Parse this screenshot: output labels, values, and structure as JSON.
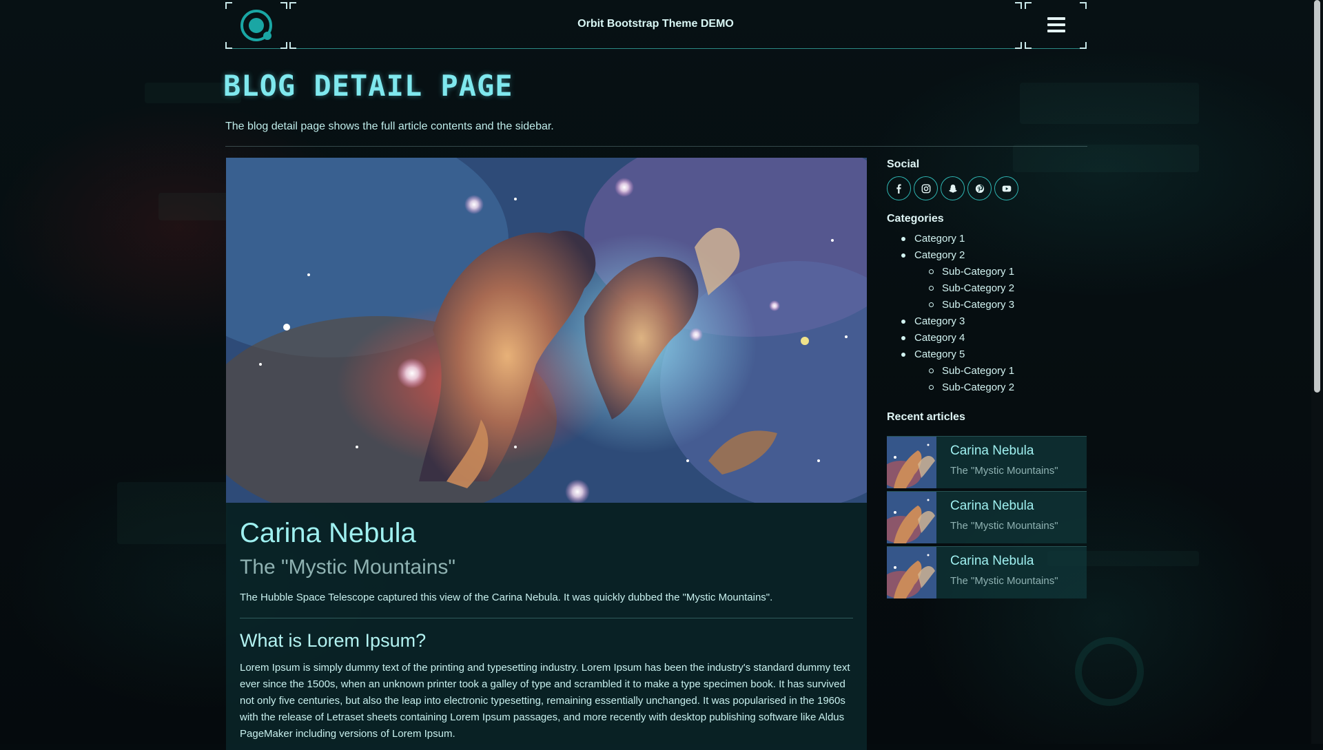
{
  "header": {
    "site_title": "Orbit Bootstrap Theme DEMO",
    "logo_icon": "orbit-logo",
    "menu_icon": "hamburger-icon"
  },
  "page": {
    "heading": "BLOG DETAIL PAGE",
    "lead": "The blog detail page shows the full article contents and the sidebar."
  },
  "article": {
    "image": "carina-nebula-image",
    "title": "Carina Nebula",
    "subtitle": "The \"Mystic Mountains\"",
    "intro": "The Hubble Space Telescope captured this view of the Carina Nebula. It was quickly dubbed the \"Mystic Mountains\".",
    "section_heading": "What is Lorem Ipsum?",
    "section_text": "Lorem Ipsum is simply dummy text of the printing and typesetting industry. Lorem Ipsum has been the industry's standard dummy text ever since the 1500s, when an unknown printer took a galley of type and scrambled it to make a type specimen book. It has survived not only five centuries, but also the leap into electronic typesetting, remaining essentially unchanged. It was popularised in the 1960s with the release of Letraset sheets containing Lorem Ipsum passages, and more recently with desktop publishing software like Aldus PageMaker including versions of Lorem Ipsum."
  },
  "sidebar": {
    "social_title": "Social",
    "social_icons": [
      "facebook-icon",
      "instagram-icon",
      "snapchat-icon",
      "pinterest-icon",
      "youtube-icon"
    ],
    "categories_title": "Categories",
    "categories": [
      {
        "label": "Category 1",
        "subs": []
      },
      {
        "label": "Category 2",
        "subs": [
          "Sub-Category 1",
          "Sub-Category 2",
          "Sub-Category 3"
        ]
      },
      {
        "label": "Category 3",
        "subs": []
      },
      {
        "label": "Category 4",
        "subs": []
      },
      {
        "label": "Category 5",
        "subs": [
          "Sub-Category 1",
          "Sub-Category 2"
        ]
      }
    ],
    "recent_title": "Recent articles",
    "recent": [
      {
        "title": "Carina Nebula",
        "subtitle": "The \"Mystic Mountains\""
      },
      {
        "title": "Carina Nebula",
        "subtitle": "The \"Mystic Mountains\""
      },
      {
        "title": "Carina Nebula",
        "subtitle": "The \"Mystic Mountains\""
      }
    ]
  },
  "colors": {
    "accent": "#1aa6a4",
    "heading": "#7fe8ee",
    "background": "#050b0e"
  }
}
